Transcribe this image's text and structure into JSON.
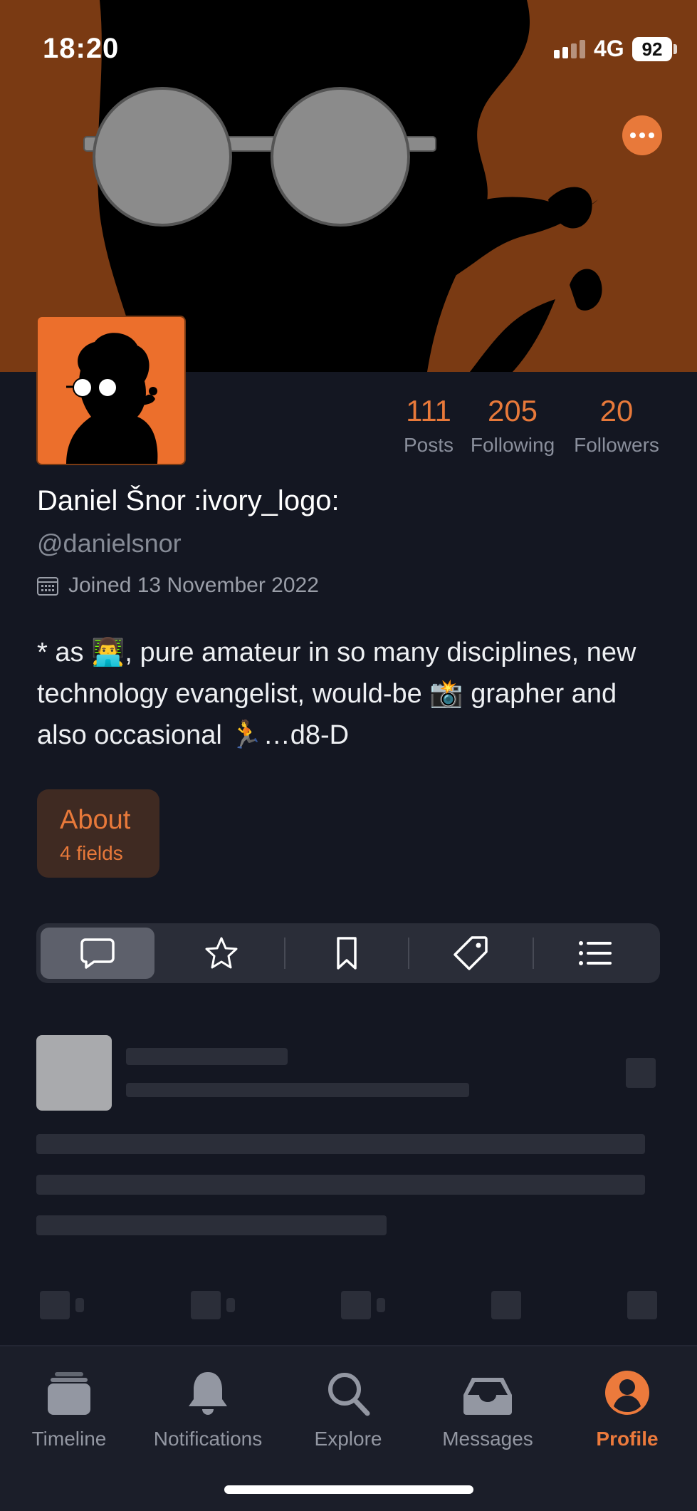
{
  "status_bar": {
    "time": "18:20",
    "network": "4G",
    "battery": "92"
  },
  "profile": {
    "display_name": "Daniel Šnor :ivory_logo:",
    "handle": "@danielsnor",
    "joined": "Joined 13 November 2022",
    "bio": "* as 👨‍💻, pure amateur in so many disciplines, new technology evangelist, would-be 📸 grapher and also occasional 🏃…d8-D",
    "stats": [
      {
        "value": "111",
        "label": "Posts"
      },
      {
        "value": "205",
        "label": "Following"
      },
      {
        "value": "20",
        "label": "Followers"
      }
    ],
    "about": {
      "title": "About",
      "subtitle": "4 fields"
    }
  },
  "segments": [
    {
      "icon": "speech-bubble-icon",
      "active": true
    },
    {
      "icon": "star-icon",
      "active": false
    },
    {
      "icon": "bookmark-icon",
      "active": false
    },
    {
      "icon": "tag-icon",
      "active": false
    },
    {
      "icon": "list-icon",
      "active": false
    }
  ],
  "tabbar": {
    "items": [
      {
        "label": "Timeline",
        "icon": "timeline-icon"
      },
      {
        "label": "Notifications",
        "icon": "bell-icon"
      },
      {
        "label": "Explore",
        "icon": "search-icon"
      },
      {
        "label": "Messages",
        "icon": "inbox-icon"
      },
      {
        "label": "Profile",
        "icon": "profile-icon",
        "active": true
      }
    ]
  },
  "colors": {
    "accent": "#e8793a",
    "background": "#141722",
    "banner": "#7a3a13",
    "avatar_bg": "#ec6f2c"
  }
}
